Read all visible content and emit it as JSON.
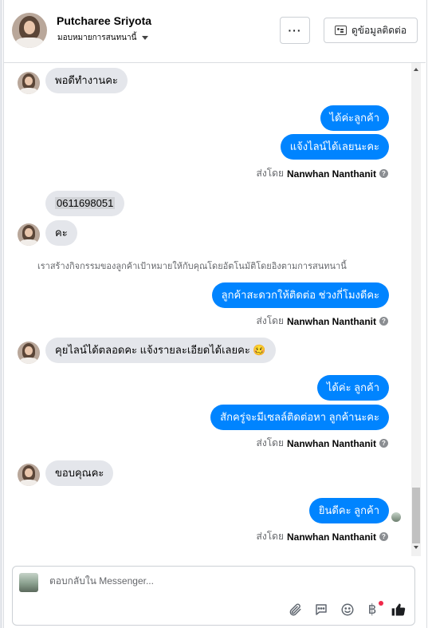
{
  "header": {
    "contact_name": "Putcharee Sriyota",
    "assignment_label": "มอบหมายการสนทนานี้",
    "more_button_label": "···",
    "contact_info_button_label": "ดูข้อมูลติดต่อ"
  },
  "messages": {
    "in_1": "พอดีทำงานคะ",
    "out_1a": "ได้ค่ะลูกค้า",
    "out_1b": "แจ้งไลน์ได้เลยนะคะ",
    "in_2a": "0611698051",
    "in_2b": "คะ",
    "system_note": "เราสร้างกิจกรรมของลูกค้าเป้าหมายให้กับคุณโดยอัตโนมัติโดยอิงตามการสนทนานี้",
    "out_2": "ลูกค้าสะดวกให้ติดต่อ ช่วงกี่โมงดีคะ",
    "in_3": "คุยไลน์ได้ตลอดคะ แจ้งรายละเอียดได้เลยคะ 🥴",
    "out_3a": "ได้ค่ะ ลูกค้า",
    "out_3b": "สักครู่จะมีเซลล์ติดต่อหา ลูกค้านะคะ",
    "in_4": "ขอบคุณคะ",
    "out_4": "ยินดีคะ ลูกค้า"
  },
  "sent_by": {
    "prefix": "ส่งโดย",
    "agent": "Nanwhan Nanthanit",
    "help_glyph": "?"
  },
  "composer": {
    "placeholder": "ตอบกลับใน Messenger..."
  },
  "icons": {
    "attach": "paperclip-icon",
    "saved_replies": "chat-bubble-icon",
    "emoji": "smiley-icon",
    "payment": "baht-icon",
    "like": "thumbs-up-icon"
  },
  "colors": {
    "outgoing_bubble": "#0084ff",
    "incoming_bubble": "#e4e6eb",
    "notification_dot": "#f02849"
  }
}
